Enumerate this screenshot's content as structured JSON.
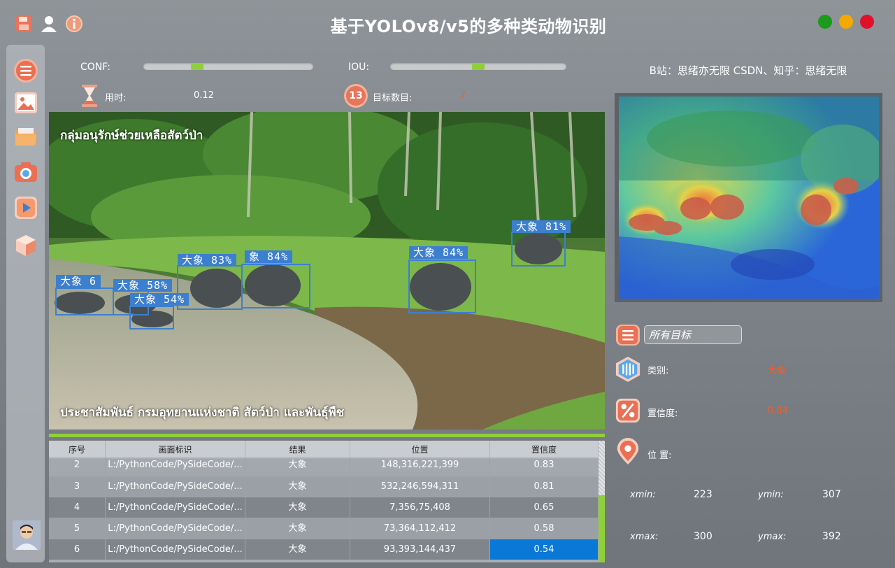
{
  "app": {
    "title": "基于YOLOv8/v5的多种类动物识别",
    "window_controls": [
      "maximize-green",
      "minimize-yellow",
      "close-red"
    ]
  },
  "toolbar": {
    "icons": [
      "save-icon",
      "user-icon",
      "info-icon"
    ]
  },
  "sidebar": {
    "items": [
      {
        "name": "menu-icon"
      },
      {
        "name": "image-icon"
      },
      {
        "name": "folder-icon"
      },
      {
        "name": "camera-icon"
      },
      {
        "name": "video-play-icon"
      },
      {
        "name": "model-cube-icon"
      }
    ]
  },
  "controls": {
    "conf_label": "CONF:",
    "conf_value": 0.3,
    "iou_label": "IOU:",
    "iou_value": 0.5,
    "time_label": "用时:",
    "time_value": "0.12",
    "count_label": "目标数目:",
    "count_value": "7",
    "count_badge": "13"
  },
  "detections": [
    {
      "label": "大象 6",
      "box_id": "det-1"
    },
    {
      "label": "大象 58%",
      "box_id": "det-2"
    },
    {
      "label": "大象 54%",
      "box_id": "det-3"
    },
    {
      "label": "大象 83%",
      "box_id": "det-4"
    },
    {
      "label": "象 84%",
      "box_id": "det-5"
    },
    {
      "label": "大象 84%",
      "box_id": "det-6"
    },
    {
      "label": "大象 81%",
      "box_id": "det-7"
    }
  ],
  "overlay_text": {
    "top": "กลุ่มอนุรักษ์ช่วยเหลือสัตว์ป่า",
    "bottom": "ประชาสัมพันธ์ กรมอุทยานแห่งชาติ สัตว์ป่า และพันธุ์พืช"
  },
  "table": {
    "headers": [
      "序号",
      "画面标识",
      "结果",
      "位置",
      "置信度"
    ],
    "rows": [
      {
        "id": "2",
        "path": "L:/PythonCode/PySideCode/...",
        "result": "大象",
        "pos": "148,316,221,399",
        "conf": "0.83"
      },
      {
        "id": "3",
        "path": "L:/PythonCode/PySideCode/...",
        "result": "大象",
        "pos": "532,246,594,311",
        "conf": "0.81"
      },
      {
        "id": "4",
        "path": "L:/PythonCode/PySideCode/...",
        "result": "大象",
        "pos": "7,356,75,408",
        "conf": "0.65"
      },
      {
        "id": "5",
        "path": "L:/PythonCode/PySideCode/...",
        "result": "大象",
        "pos": "73,364,112,412",
        "conf": "0.58"
      },
      {
        "id": "6",
        "path": "L:/PythonCode/PySideCode/...",
        "result": "大象",
        "pos": "93,393,144,437",
        "conf": "0.54"
      }
    ]
  },
  "right_panel": {
    "watermark": "B站：思绪亦无限  CSDN、知乎：思绪无限",
    "target_select": "所有目标",
    "class_label": "类别:",
    "class_value": "大象",
    "conf_label": "置信度:",
    "conf_value": "0.84",
    "pos_label": "位 置:",
    "xmin_label": "xmin:",
    "xmin": "223",
    "ymin_label": "ymin:",
    "ymin": "307",
    "xmax_label": "xmax:",
    "xmax": "300",
    "ymax_label": "ymax:",
    "ymax": "392"
  },
  "colors": {
    "accent_green": "#8fcf3a",
    "value_orange": "#ff5a1f",
    "selection_blue": "#0a78d7",
    "box_blue": "#3d7fcf"
  }
}
